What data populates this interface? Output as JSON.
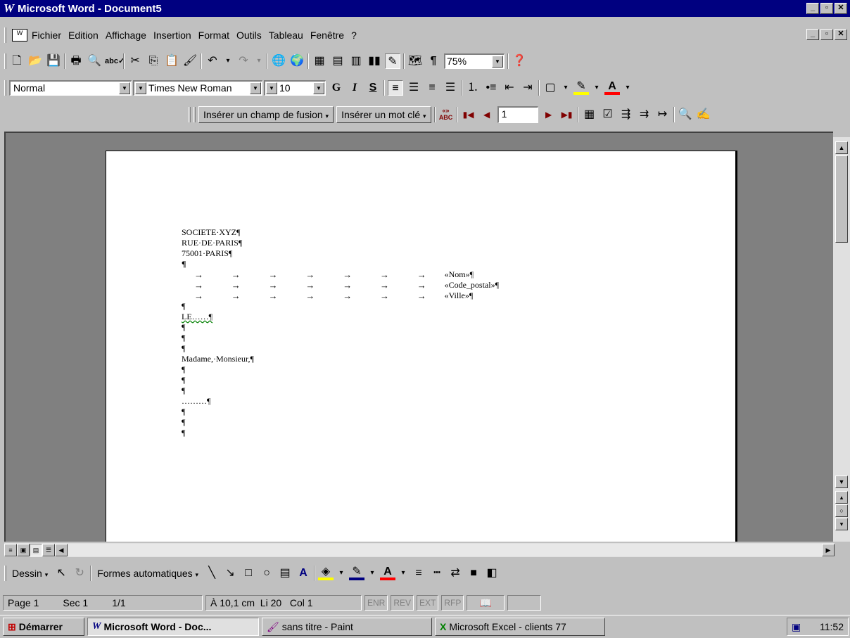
{
  "titlebar": {
    "title": "Microsoft Word - Document5",
    "bg": "#000080"
  },
  "menu": {
    "items": [
      {
        "label": "Fichier"
      },
      {
        "label": "Edition"
      },
      {
        "label": "Affichage"
      },
      {
        "label": "Insertion"
      },
      {
        "label": "Format"
      },
      {
        "label": "Outils"
      },
      {
        "label": "Tableau"
      },
      {
        "label": "Fenêtre"
      },
      {
        "label": "?"
      }
    ]
  },
  "standard_toolbar": {
    "zoom": "75%"
  },
  "format_toolbar": {
    "style": "Normal",
    "font": "Times New Roman",
    "size": "10",
    "bold": "G",
    "italic": "I",
    "underline": "S"
  },
  "mail_toolbar": {
    "insert_merge_field": "Insérer un champ de fusion",
    "insert_keyword": "Insérer un mot clé",
    "record": "1",
    "abc": "ABC"
  },
  "document": {
    "lines": [
      "SOCIETE·XYZ¶",
      "RUE·DE·PARIS¶",
      "75001·PARIS¶",
      "¶"
    ],
    "merge_fields": [
      "«Nom»¶",
      "«Code_postal»¶",
      "«Ville»¶"
    ],
    "lines2": [
      "¶",
      "LE……¶",
      "¶",
      "¶",
      "¶",
      "Madame,·Monsieur,¶",
      "¶",
      "¶",
      "¶",
      "………¶",
      "¶",
      "¶",
      "¶"
    ],
    "arrow": "→"
  },
  "drawing_toolbar": {
    "draw": "Dessin",
    "autoshapes": "Formes automatiques"
  },
  "statusbar": {
    "page": "Page 1",
    "sec": "Sec 1",
    "pages": "1/1",
    "position": "À 10,1 cm  Li 20   Col 1",
    "modes": [
      "ENR",
      "REV",
      "EXT",
      "RFP"
    ]
  },
  "taskbar": {
    "start": "Démarrer",
    "tasks": [
      "Microsoft Word - Doc...",
      "sans titre - Paint",
      "Microsoft Excel - clients 77"
    ],
    "time": "11:52"
  },
  "colors": {
    "highlight": "#ffff00",
    "font_color": "#ff0000",
    "desktop_dark": "#808080"
  }
}
